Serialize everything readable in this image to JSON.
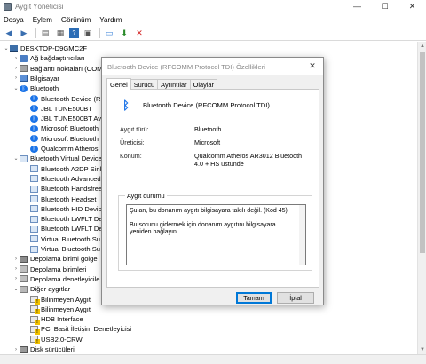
{
  "window": {
    "title": "Aygıt Yöneticisi",
    "controls": [
      "—",
      "☐",
      "✕"
    ]
  },
  "menu": [
    "Dosya",
    "Eylem",
    "Görünüm",
    "Yardım"
  ],
  "toolbar": [
    "back-icon",
    "forward-icon",
    "properties-icon",
    "help-icon",
    "computer-icon",
    "update-driver-icon",
    "uninstall-icon"
  ],
  "tree": {
    "rows": [
      {
        "label": "DESKTOP-D9GMC2F",
        "expander": "⌄",
        "icon": "pc"
      },
      {
        "label": "Ağ bağdaştırıcıları",
        "expander": "›",
        "icon": "net"
      },
      {
        "label": "Bağlantı noktaları (COM",
        "expander": "›",
        "icon": "port"
      },
      {
        "label": "Bilgisayar",
        "expander": "›",
        "icon": "computer"
      },
      {
        "label": "Bluetooth",
        "expander": "⌄",
        "icon": "bt"
      },
      {
        "label": "Bluetooth Device (RF",
        "expander": "",
        "icon": "bt"
      },
      {
        "label": "JBL TUNE500BT",
        "expander": "",
        "icon": "bt"
      },
      {
        "label": "JBL TUNE500BT Avrc",
        "expander": "",
        "icon": "bt"
      },
      {
        "label": "Microsoft Bluetooth",
        "expander": "",
        "icon": "bt"
      },
      {
        "label": "Microsoft Bluetooth",
        "expander": "",
        "icon": "bt"
      },
      {
        "label": "Qualcomm Atheros",
        "expander": "",
        "icon": "bt"
      },
      {
        "label": "Bluetooth Virtual Device",
        "expander": "⌄",
        "icon": "bt-dev"
      },
      {
        "label": "Bluetooth A2DP Sink",
        "expander": "",
        "icon": "bt-dev"
      },
      {
        "label": "Bluetooth Advanced",
        "expander": "",
        "icon": "bt-dev"
      },
      {
        "label": "Bluetooth Handsfree",
        "expander": "",
        "icon": "bt-dev"
      },
      {
        "label": "Bluetooth Headset",
        "expander": "",
        "icon": "bt-dev"
      },
      {
        "label": "Bluetooth HID Device",
        "expander": "",
        "icon": "bt-dev"
      },
      {
        "label": "Bluetooth LWFLT De",
        "expander": "",
        "icon": "bt-dev"
      },
      {
        "label": "Bluetooth LWFLT De",
        "expander": "",
        "icon": "bt-dev"
      },
      {
        "label": "Virtual Bluetooth Su",
        "expander": "",
        "icon": "bt-dev"
      },
      {
        "label": "Virtual Bluetooth Su",
        "expander": "",
        "icon": "bt-dev"
      },
      {
        "label": "Depolama birimi gölge",
        "expander": "›",
        "icon": "disk"
      },
      {
        "label": "Depolama birimleri",
        "expander": "›",
        "icon": "storage"
      },
      {
        "label": "Depolama denetleyicile",
        "expander": "›",
        "icon": "storage"
      },
      {
        "label": "Diğer aygıtlar",
        "expander": "⌄",
        "icon": "other"
      },
      {
        "label": "Bilinmeyen Aygıt",
        "expander": "",
        "icon": "warn"
      },
      {
        "label": "Bilinmeyen Aygıt",
        "expander": "",
        "icon": "warn"
      },
      {
        "label": "HDB Interface",
        "expander": "",
        "icon": "warn"
      },
      {
        "label": "PCI Basit İletişim Denetleyicisi",
        "expander": "",
        "icon": "warn"
      },
      {
        "label": "USB2.0-CRW",
        "expander": "",
        "icon": "warn"
      },
      {
        "label": "Disk sürücüleri",
        "expander": "›",
        "icon": "hdd"
      }
    ]
  },
  "dialog": {
    "title": "Bluetooth Device (RFCOMM Protocol TDI) Özellikleri",
    "close": "✕",
    "tabs": [
      "Genel",
      "Sürücü",
      "Ayrıntılar",
      "Olaylar"
    ],
    "active_tab": "Genel",
    "device_icon": "ᛒ",
    "device_name": "Bluetooth Device (RFCOMM Protocol TDI)",
    "properties": [
      {
        "label": "Aygıt türü:",
        "value": "Bluetooth"
      },
      {
        "label": "Üreticisi:",
        "value": "Microsoft"
      },
      {
        "label": "Konum:",
        "value": "Qualcomm Atheros AR3012 Bluetooth 4.0 + HS üstünde"
      }
    ],
    "status_title": "Aygıt durumu",
    "status_line1": "Şu an, bu donanım aygıtı bilgisayara takılı değil. (Kod 45)",
    "status_line2": "Bu sorunu gidermek için donanım aygıtını bilgisayara yeniden bağlayın.",
    "ok_label": "Tamam",
    "cancel_label": "İptal"
  }
}
